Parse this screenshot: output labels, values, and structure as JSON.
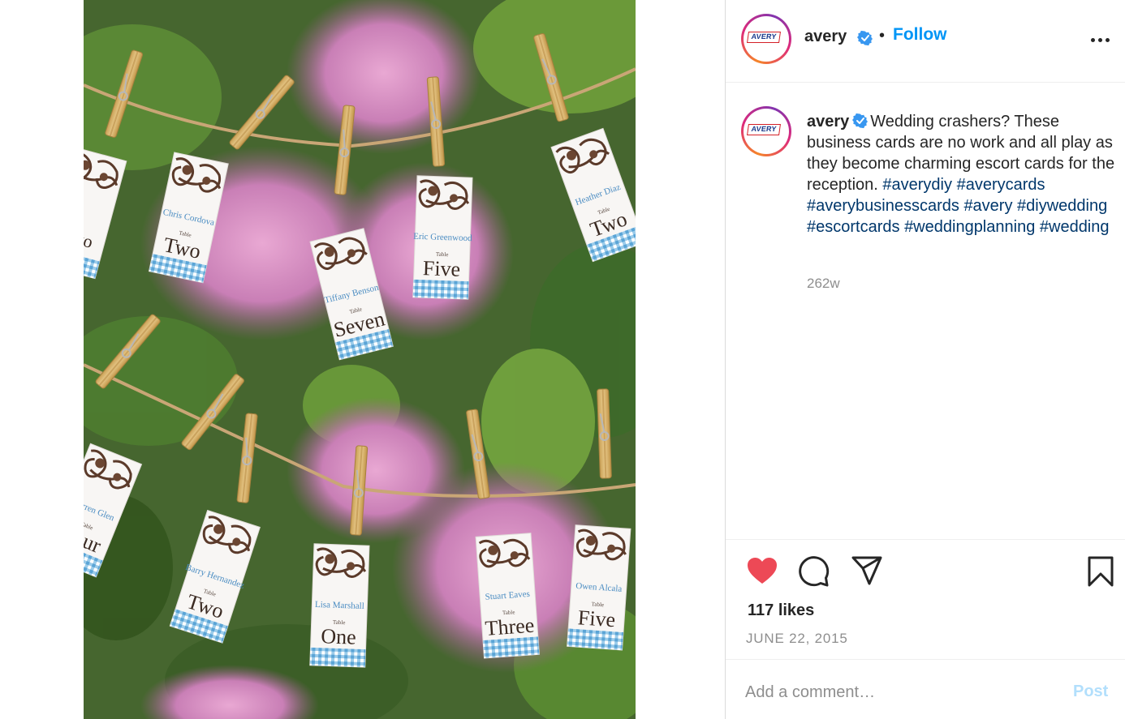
{
  "post": {
    "image_cards": [
      {
        "name": "",
        "table": "Table",
        "number": "Two"
      },
      {
        "name": "Chris Cordova",
        "table": "Table",
        "number": "Two"
      },
      {
        "name": "Tiffany Benson",
        "table": "Table",
        "number": "Seven"
      },
      {
        "name": "Eric Greenwood",
        "table": "Table",
        "number": "Five"
      },
      {
        "name": "Heather Diaz",
        "table": "Table",
        "number": "Two"
      },
      {
        "name": "Darren Glen",
        "table": "Table",
        "number": "Four"
      },
      {
        "name": "Barry Hernandez",
        "table": "Table",
        "number": "Two"
      },
      {
        "name": "Lisa Marshall",
        "table": "Table",
        "number": "One"
      },
      {
        "name": "Stuart Eaves",
        "table": "Table",
        "number": "Three"
      },
      {
        "name": "Owen Alcala",
        "table": "Table",
        "number": "Five"
      }
    ]
  },
  "header": {
    "avatar_logo": "AVERY",
    "username": "avery",
    "verified_icon": "verified-badge-icon",
    "separator": "•",
    "follow_label": "Follow",
    "more_icon": "more-options-icon"
  },
  "caption": {
    "avatar_logo": "AVERY",
    "username": "avery",
    "text": "Wedding crashers? These business cards are no work and all play as they become charming escort cards for the reception.",
    "hashtags": [
      "#averydiy",
      "#averycards",
      "#averybusinesscards",
      "#avery",
      "#diywedding",
      "#escortcards",
      "#weddingplanning",
      "#wedding"
    ],
    "time_ago": "262w"
  },
  "actions": {
    "like_icon": "heart-filled-icon",
    "comment_icon": "comment-bubble-icon",
    "share_icon": "paper-plane-icon",
    "save_icon": "bookmark-icon",
    "likes_text": "117 likes",
    "date": "JUNE 22, 2015"
  },
  "comment": {
    "placeholder": "Add a comment…",
    "post_label": "Post"
  },
  "colors": {
    "accent": "#0095f6",
    "like": "#ed4956",
    "hashtag": "#00376b",
    "muted": "#8e8e8e",
    "post_disabled": "#b2dffc",
    "card_gingham": "#6fb2d9"
  }
}
